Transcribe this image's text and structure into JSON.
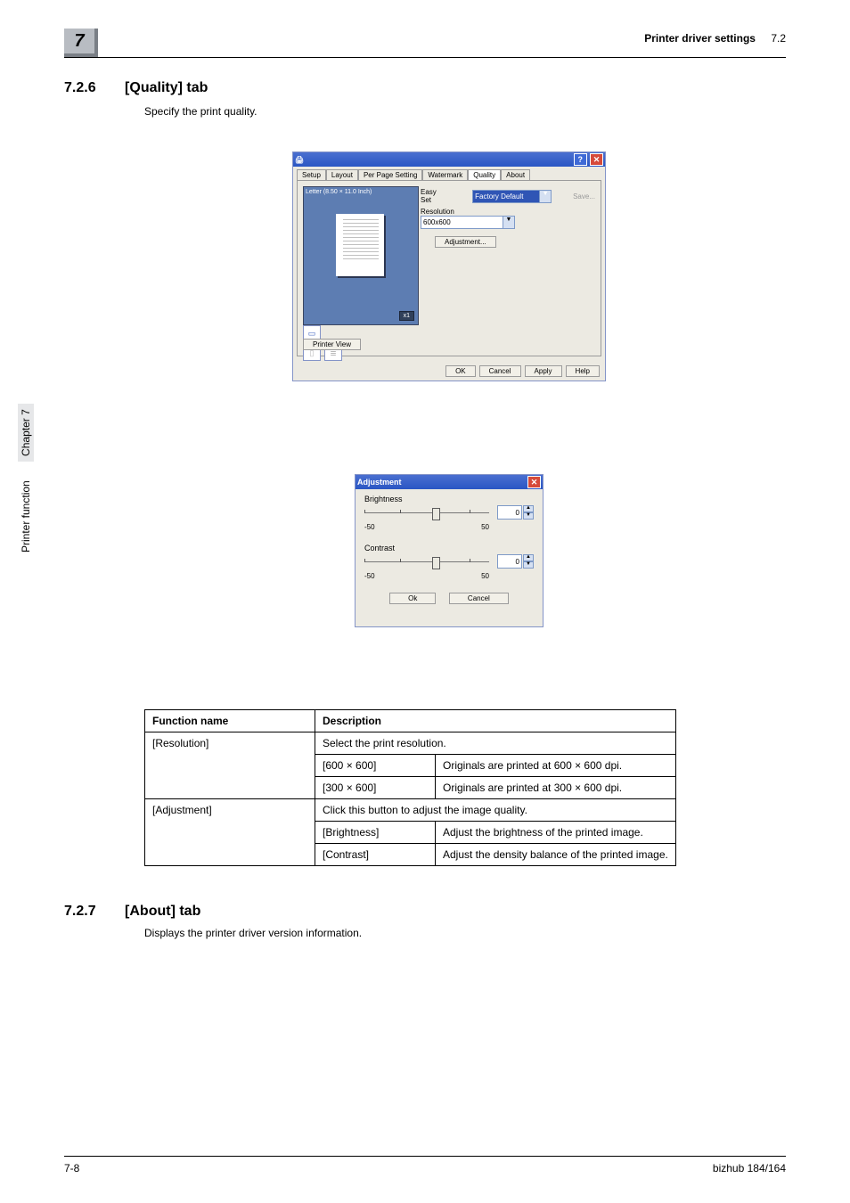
{
  "header": {
    "chapter_number": "7",
    "title": "Printer driver settings",
    "section_ref": "7.2"
  },
  "sidebar": {
    "label": "Printer function",
    "chapter_label": "Chapter 7"
  },
  "section_726": {
    "number": "7.2.6",
    "title": "[Quality] tab",
    "subtitle": "Specify the print quality."
  },
  "dialog1": {
    "titlebar_icon": "🖨",
    "tabs": [
      "Setup",
      "Layout",
      "Per Page Setting",
      "Watermark",
      "Quality",
      "About"
    ],
    "active_tab_index": 4,
    "preview_paper_label": "Letter  (8.50 × 11.0 Inch)",
    "preview_scale": "x1",
    "printer_view_btn": "Printer View",
    "easyset_label": "Easy Set",
    "easyset_value": "Factory Default",
    "easyset_save": "Save...",
    "resolution_label": "Resolution",
    "resolution_value": "600x600",
    "adjustment_btn": "Adjustment...",
    "footer_buttons": [
      "OK",
      "Cancel",
      "Apply",
      "Help"
    ]
  },
  "dialog2": {
    "title": "Adjustment",
    "brightness": {
      "label": "Brightness",
      "min": "-50",
      "max": "50",
      "value": "0"
    },
    "contrast": {
      "label": "Contrast",
      "min": "-50",
      "max": "50",
      "value": "0"
    },
    "buttons": {
      "ok": "Ok",
      "cancel": "Cancel"
    }
  },
  "table": {
    "header": {
      "fn": "Function name",
      "desc": "Description"
    },
    "rows": {
      "resolution": {
        "name": "[Resolution]",
        "desc": "Select the print resolution.",
        "sub": [
          {
            "k": "[600 × 600]",
            "v": "Originals are printed at 600 × 600 dpi."
          },
          {
            "k": "[300 × 600]",
            "v": "Originals are printed at 300 × 600 dpi."
          }
        ]
      },
      "adjustment": {
        "name": "[Adjustment]",
        "desc": "Click this button to adjust the image quality.",
        "sub": [
          {
            "k": "[Brightness]",
            "v": "Adjust the brightness of the printed image."
          },
          {
            "k": "[Contrast]",
            "v": "Adjust the density balance of the printed image."
          }
        ]
      }
    }
  },
  "section_727": {
    "number": "7.2.7",
    "title": "[About] tab",
    "subtitle": "Displays the printer driver version information."
  },
  "footer": {
    "page": "7-8",
    "product": "bizhub 184/164"
  }
}
